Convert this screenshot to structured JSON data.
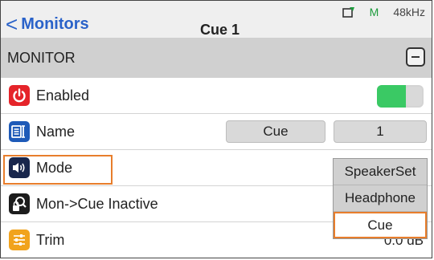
{
  "header": {
    "back_label": "Monitors",
    "title": "Cue 1",
    "status_m": "M",
    "sample_rate": "48kHz"
  },
  "section": {
    "label": "MONITOR"
  },
  "rows": {
    "enabled": {
      "label": "Enabled",
      "value_on": true
    },
    "name": {
      "label": "Name",
      "field_name": "Cue",
      "field_number": "1"
    },
    "mode": {
      "label": "Mode"
    },
    "mon_cue": {
      "label": "Mon->Cue Inactive"
    },
    "trim": {
      "label": "Trim",
      "value": "0.0 dB"
    }
  },
  "mode_dropdown": {
    "options": [
      "SpeakerSet",
      "Headphone",
      "Cue"
    ],
    "selected": "Cue"
  },
  "colors": {
    "accent": "#2a62c9",
    "highlight": "#e87e2c",
    "toggle_on": "#3ac964"
  }
}
